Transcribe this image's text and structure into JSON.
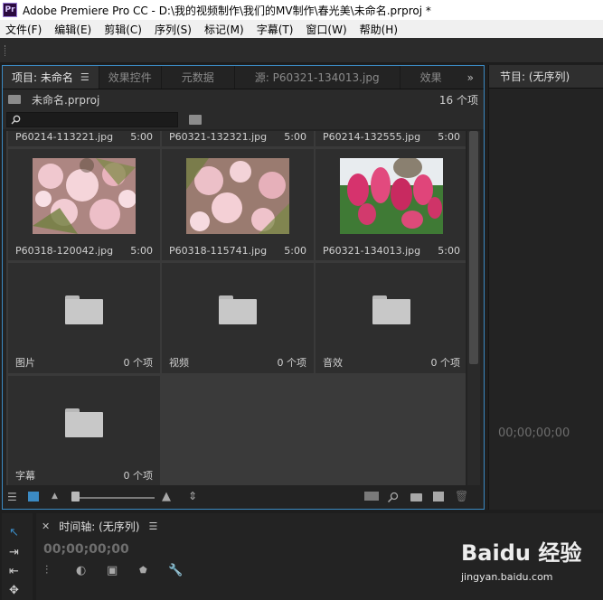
{
  "titlebar": {
    "logo": "Pr",
    "title": "Adobe Premiere Pro CC - D:\\我的视频制作\\我们的MV制作\\春光美\\未命名.prproj *"
  },
  "menubar": {
    "items": [
      "文件(F)",
      "编辑(E)",
      "剪辑(C)",
      "序列(S)",
      "标记(M)",
      "字幕(T)",
      "窗口(W)",
      "帮助(H)"
    ]
  },
  "project_panel": {
    "tabs": [
      {
        "label": "项目: 未命名",
        "active": true
      },
      {
        "label": "效果控件",
        "active": false
      },
      {
        "label": "元数据",
        "active": false
      },
      {
        "label": "源: P60321-134013.jpg",
        "active": false
      },
      {
        "label": "效果",
        "active": false
      }
    ],
    "project_file": "未命名.prproj",
    "item_count": "16 个项",
    "search": {
      "value": "",
      "placeholder": ""
    },
    "top_row": [
      {
        "name": "P60214-113221.jpg",
        "duration": "5:00"
      },
      {
        "name": "P60321-132321.jpg",
        "duration": "5:00"
      },
      {
        "name": "P60214-132555.jpg",
        "duration": "5:00"
      }
    ],
    "image_row": [
      {
        "name": "P60318-120042.jpg",
        "duration": "5:00"
      },
      {
        "name": "P60318-115741.jpg",
        "duration": "5:00"
      },
      {
        "name": "P60321-134013.jpg",
        "duration": "5:00"
      }
    ],
    "bins": [
      {
        "name": "图片",
        "count": "0 个项"
      },
      {
        "name": "视频",
        "count": "0 个项"
      },
      {
        "name": "音效",
        "count": "0 个项"
      },
      {
        "name": "字幕",
        "count": "0 个项"
      }
    ]
  },
  "program_panel": {
    "tab": "节目: (无序列)",
    "timecode": "00;00;00;00"
  },
  "timeline_panel": {
    "title": "时间轴: (无序列)",
    "timecode": "00;00;00;00"
  },
  "watermark": {
    "brand": "Baidu 经验",
    "url": "jingyan.baidu.com"
  },
  "colors": {
    "accent": "#3b8ac3",
    "panel_bg": "#232323",
    "grid_bg": "#3a3a3a"
  }
}
